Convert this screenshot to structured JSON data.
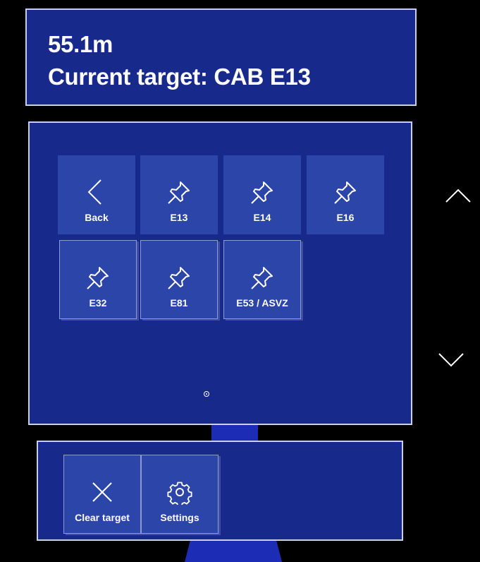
{
  "info": {
    "distance": "55.1m",
    "target": "Current target: CAB E13"
  },
  "menu": {
    "tiles": [
      {
        "label": "Back",
        "icon": "chevron-left-icon"
      },
      {
        "label": "E13",
        "icon": "pin-icon"
      },
      {
        "label": "E14",
        "icon": "pin-icon"
      },
      {
        "label": "E16",
        "icon": "pin-icon"
      },
      {
        "label": "E32",
        "icon": "pin-icon"
      },
      {
        "label": "E81",
        "icon": "pin-icon"
      },
      {
        "label": "E53 / ASVZ",
        "icon": "pin-icon"
      }
    ]
  },
  "actions": {
    "clear_label": "Clear target",
    "clear_icon": "close-icon",
    "settings_label": "Settings",
    "settings_icon": "gear-icon"
  },
  "scroll": {
    "up_icon": "chevron-up-icon",
    "down_icon": "chevron-down-icon"
  },
  "colors": {
    "panel": "#172a8c",
    "tile": "#2b45a8",
    "border": "#c9cfe6",
    "background": "#000000"
  }
}
